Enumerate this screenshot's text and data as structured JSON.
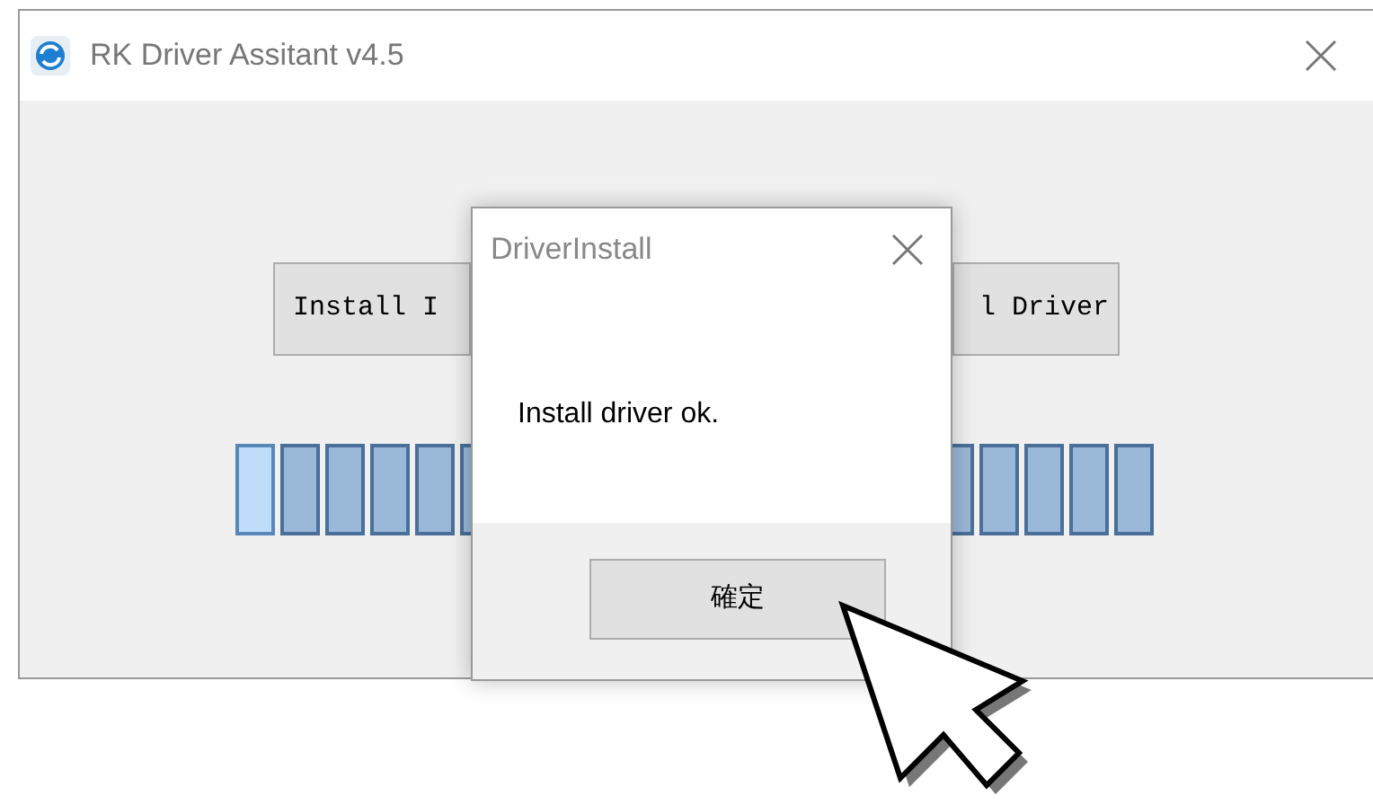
{
  "window": {
    "title": "RK Driver Assitant v4.5"
  },
  "buttons": [
    "Install I",
    "l Driver"
  ],
  "progress": {
    "left_blocks": [
      {
        "highlighted": true
      },
      {
        "highlighted": false
      },
      {
        "highlighted": false
      },
      {
        "highlighted": false
      },
      {
        "highlighted": false
      },
      {
        "highlighted": false
      }
    ],
    "right_blocks": [
      {
        "highlighted": false
      },
      {
        "highlighted": false
      },
      {
        "highlighted": false
      },
      {
        "highlighted": false
      },
      {
        "highlighted": false
      }
    ]
  },
  "dialog": {
    "title": "DriverInstall",
    "message": "Install driver ok.",
    "button": "確定"
  }
}
